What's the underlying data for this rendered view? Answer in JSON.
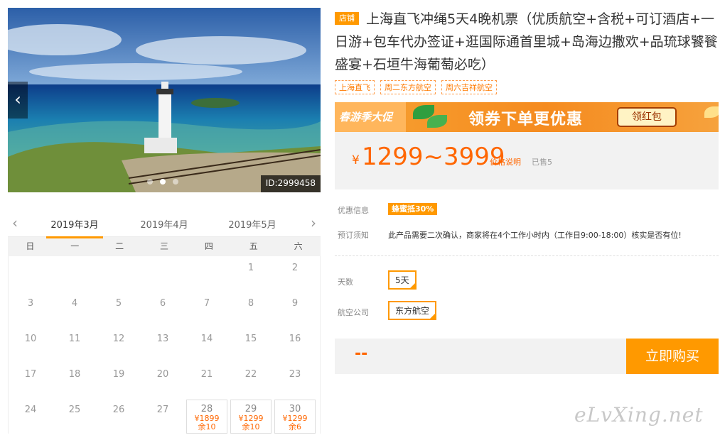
{
  "gallery": {
    "prev_glyph": "‹",
    "next_glyph": "›",
    "id_label": "ID:2999458",
    "dot_count": 3,
    "active_dot": 1
  },
  "calendar": {
    "months": [
      "2019年3月",
      "2019年4月",
      "2019年5月"
    ],
    "active_month": 0,
    "weekdays": [
      "日",
      "一",
      "二",
      "三",
      "四",
      "五",
      "六"
    ],
    "weeks": [
      [
        null,
        null,
        null,
        null,
        null,
        {
          "day": "1"
        },
        {
          "day": "2"
        }
      ],
      [
        {
          "day": "3"
        },
        {
          "day": "4"
        },
        {
          "day": "5"
        },
        {
          "day": "6"
        },
        {
          "day": "7"
        },
        {
          "day": "8"
        },
        {
          "day": "9"
        }
      ],
      [
        {
          "day": "10"
        },
        {
          "day": "11"
        },
        {
          "day": "12"
        },
        {
          "day": "13"
        },
        {
          "day": "14"
        },
        {
          "day": "15"
        },
        {
          "day": "16"
        }
      ],
      [
        {
          "day": "17"
        },
        {
          "day": "18"
        },
        {
          "day": "19"
        },
        {
          "day": "20"
        },
        {
          "day": "21"
        },
        {
          "day": "22"
        },
        {
          "day": "23"
        }
      ],
      [
        {
          "day": "24"
        },
        {
          "day": "25"
        },
        {
          "day": "26"
        },
        {
          "day": "27"
        },
        {
          "day": "28",
          "price": "¥1899",
          "left": "余10"
        },
        {
          "day": "29",
          "price": "¥1299",
          "left": "余10"
        },
        {
          "day": "30",
          "price": "¥1299",
          "left": "余6"
        }
      ]
    ]
  },
  "product": {
    "shop_badge": "店铺",
    "title": "上海直飞冲绳5天4晚机票（优质航空+含税+可订酒店+一日游+包车代办签证+逛国际通首里城+岛海边撒欢+品琉球饕餮盛宴+石垣牛海葡萄必吃）",
    "tags": [
      "上海直飞",
      "周二东方航空",
      "周六吉祥航空"
    ]
  },
  "banner": {
    "festival": "春游季大促",
    "slogan": "领券下单更优惠",
    "button": "领红包"
  },
  "price": {
    "currency": "¥",
    "range": "1299~3999",
    "explain": "价格说明",
    "sold": "已售5"
  },
  "info": {
    "discount_label": "优惠信息",
    "discount_value": "蜂蜜抵30%",
    "notice_label": "预订须知",
    "notice_value": "此产品需要二次确认，商家将在4个工作小时内（工作日9:00-18:00）核实是否有位!"
  },
  "options": {
    "days_label": "天数",
    "days_value": "5天",
    "airline_label": "航空公司",
    "airline_value": "东方航空"
  },
  "buy": {
    "total": "--",
    "button": "立即购买"
  },
  "watermark": "eLvXing.net",
  "colors": {
    "accent": "#ff9900",
    "price": "#ff6600"
  }
}
